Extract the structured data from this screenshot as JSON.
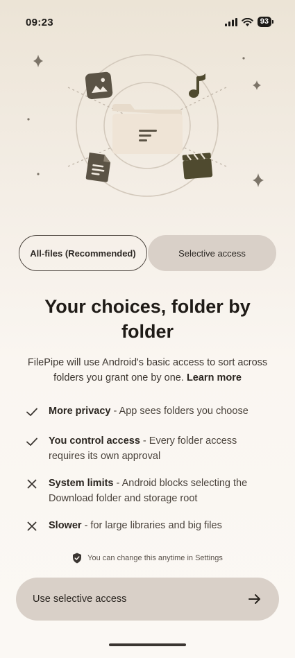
{
  "status_bar": {
    "time": "09:23",
    "battery": "93"
  },
  "toggle": {
    "all_files_label": "All-files (Recommended)",
    "selective_label": "Selective access"
  },
  "main": {
    "title_line1": "Your choices, folder by",
    "title_line2": "folder",
    "description": "FilePipe will use Android's basic access to sort across folders you grant one by one.",
    "learn_more": "Learn more"
  },
  "features": [
    {
      "icon": "check-icon",
      "title": "More privacy",
      "text": " - App sees folders you choose"
    },
    {
      "icon": "check-icon",
      "title": "You control access",
      "text": " - Every folder access requires its own approval"
    },
    {
      "icon": "close-icon",
      "title": "System limits",
      "text": " - Android blocks selecting the Download folder and storage root"
    },
    {
      "icon": "close-icon",
      "title": "Slower",
      "text": " - for large libraries and big files"
    }
  ],
  "note": {
    "icon": "shield-check-icon",
    "text": "You can change this anytime in Settings"
  },
  "cta": {
    "label": "Use selective access",
    "icon": "arrow-right-icon"
  },
  "colors": {
    "accent_brown": "#5b5345",
    "accent_olive": "#4f4a2f",
    "button_bg": "#d9d0c8",
    "folder": "#efe4d6"
  }
}
